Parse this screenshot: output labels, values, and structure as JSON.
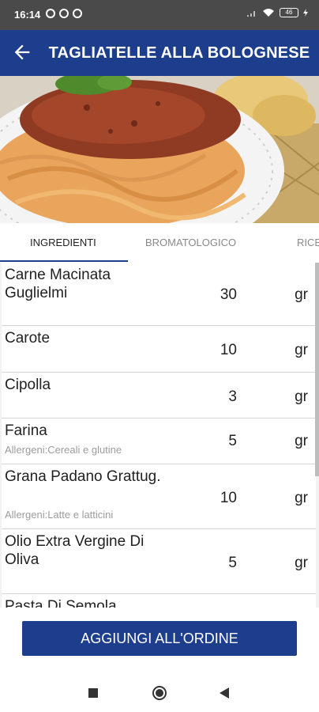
{
  "status": {
    "time": "16:14",
    "battery": "46"
  },
  "header": {
    "title": "TAGLIATELLE ALLA BOLOGNESE"
  },
  "tabs": [
    {
      "label": "INGREDIENTI",
      "active": true
    },
    {
      "label": "BROMATOLOGICO",
      "active": false
    },
    {
      "label": "RICE",
      "active": false
    }
  ],
  "ingredients": [
    {
      "name": "Carne Macinata Guglielmi",
      "allergen": "",
      "qty": "30",
      "unit": "gr"
    },
    {
      "name": "Carote",
      "allergen": "",
      "qty": "10",
      "unit": "gr"
    },
    {
      "name": "Cipolla",
      "allergen": "",
      "qty": "3",
      "unit": "gr"
    },
    {
      "name": "Farina",
      "allergen": "Allergeni:Cereali e glutine",
      "qty": "5",
      "unit": "gr"
    },
    {
      "name": "Grana Padano Grattug.",
      "allergen": "Allergeni:Latte e latticini",
      "qty": "10",
      "unit": "gr"
    },
    {
      "name": "Olio Extra Vergine Di Oliva",
      "allergen": "",
      "qty": "5",
      "unit": "gr"
    },
    {
      "name": "Pasta Di Semola",
      "allergen": "",
      "qty": "",
      "unit": ""
    }
  ],
  "footer": {
    "order_label": "AGGIUNGI ALL'ORDINE"
  },
  "colors": {
    "primary": "#1d3e8c",
    "status_bar": "#4a4a4a"
  }
}
